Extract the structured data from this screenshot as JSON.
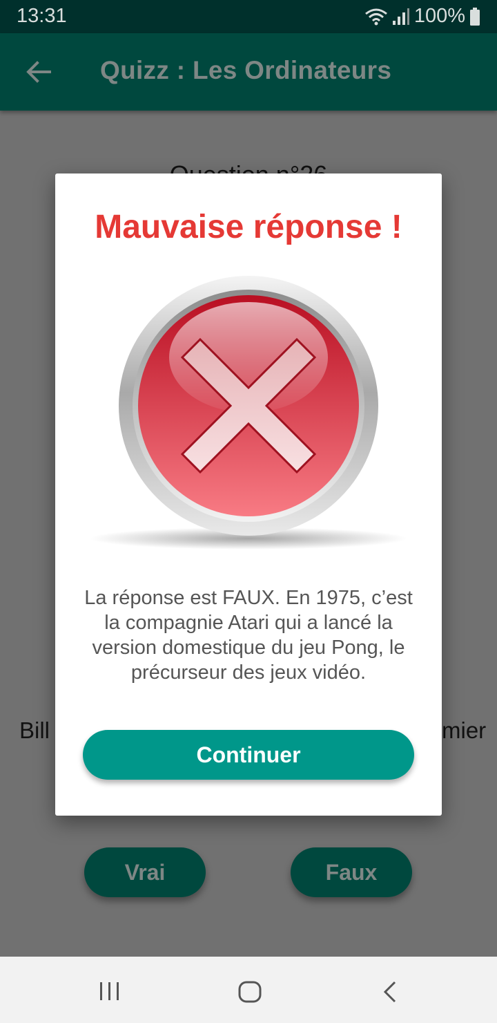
{
  "status_bar": {
    "time": "13:31",
    "battery": "100%"
  },
  "app_bar": {
    "title": "Quizz : Les Ordinateurs",
    "back_icon": "arrow-left-icon"
  },
  "question": {
    "number": "Question n°26",
    "text_left_fragment": "Bill",
    "text_right_fragment": "mier"
  },
  "answers": {
    "true_label": "Vrai",
    "false_label": "Faux"
  },
  "dialog": {
    "title": "Mauvaise réponse !",
    "icon": "wrong-answer-x-icon",
    "message": "La réponse est FAUX. En 1975, c’est la compagnie Atari qui a lancé la version domestique du jeu Pong, le précurseur des jeux vidéo.",
    "continue_label": "Continuer"
  },
  "colors": {
    "status_bar": "#00302c",
    "app_bar": "#00483e",
    "accent": "#00978a",
    "error": "#e53935",
    "overlay": "#717171"
  },
  "nav_bar": {
    "icons": [
      "recent-apps-icon",
      "home-icon",
      "back-nav-icon"
    ]
  }
}
